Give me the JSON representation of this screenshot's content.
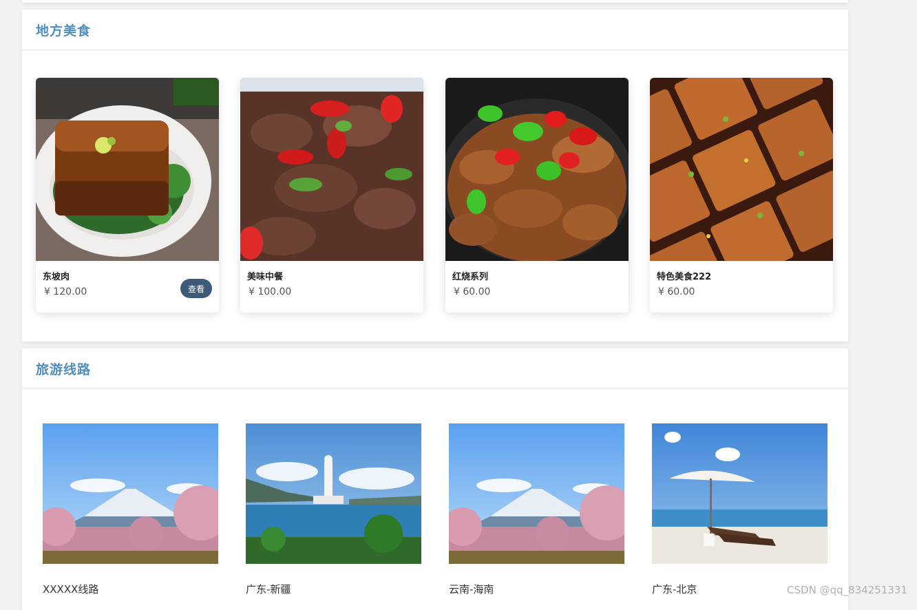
{
  "sections": {
    "food": {
      "title": "地方美食",
      "items": [
        {
          "name": "东坡肉",
          "price": "¥ 120.00",
          "image": "dongpo-pork-photo"
        },
        {
          "name": "美味中餐",
          "price": "¥ 100.00",
          "image": "stir-fry-liver-photo"
        },
        {
          "name": "红烧系列",
          "price": "¥ 60.00",
          "image": "braised-intestine-photo"
        },
        {
          "name": "特色美食222",
          "price": "¥ 60.00",
          "image": "fried-tofu-photo"
        }
      ],
      "view_label": "查看"
    },
    "tours": {
      "title": "旅游线路",
      "items": [
        {
          "name": "XXXXX线路",
          "image": "mount-fuji-photo"
        },
        {
          "name": "广东-新疆",
          "image": "guanyin-statue-sea-photo"
        },
        {
          "name": "云南-海南",
          "image": "mount-fuji-photo"
        },
        {
          "name": "广东-北京",
          "image": "beach-umbrella-photo"
        }
      ]
    }
  },
  "watermark": "CSDN @qq_834251331",
  "colors": {
    "title": "#4f8ec0",
    "button": "#3d5a78",
    "background": "#f2f2f2"
  }
}
